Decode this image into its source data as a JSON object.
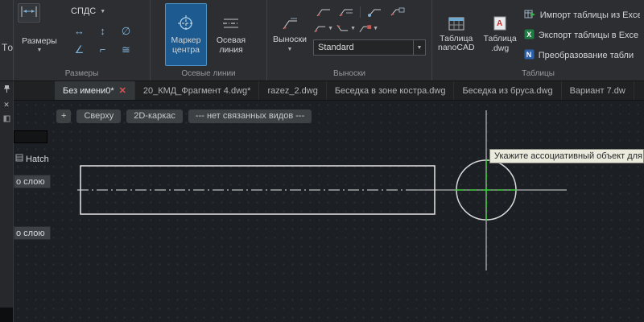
{
  "ribbon": {
    "partial_left_text": "Тo",
    "groups": {
      "dimensions": {
        "label": "Размеры",
        "spds_dropdown": "СПДС",
        "razmery_dropdown": "Размеры"
      },
      "axis_lines": {
        "label": "Осевые линии",
        "center_marker": "Маркер центра",
        "axis_line": "Осевая линия"
      },
      "leaders": {
        "label": "Выноски",
        "leaders_dropdown": "Выноски",
        "style_combo": "Standard"
      },
      "tables": {
        "label": "Таблицы",
        "table_nanocad": "Таблица nanoCAD",
        "table_dwg": "Таблица .dwg",
        "import_excel": "Импорт таблицы из Exce",
        "export_excel": "Экспорт таблицы в Exce",
        "convert_tables": "Преобразование табли"
      }
    }
  },
  "tabs": [
    {
      "label": "Без имени0*",
      "close": "✕"
    },
    {
      "label": "20_КМД_Фрагмент 4.dwg*"
    },
    {
      "label": "razez_2.dwg"
    },
    {
      "label": "Беседка в зоне костра.dwg"
    },
    {
      "label": "Беседка из бруса.dwg"
    },
    {
      "label": "Вариант 7.dw"
    }
  ],
  "viewport_controls": {
    "add": "+",
    "view_name": "Сверху",
    "visual_style": "2D-каркас",
    "linked_views": "--- нет связанных видов ---"
  },
  "properties_panel": {
    "hatch": "Hatch",
    "bylayer_1": "о слою",
    "bylayer_2": "о слою"
  },
  "canvas": {
    "tooltip": "Укажите ассоциативный объект для"
  },
  "colors": {
    "active_tool_blue": "#1d5a8f",
    "marker_green": "#3ed33e",
    "tab_close_red": "#e25252"
  }
}
